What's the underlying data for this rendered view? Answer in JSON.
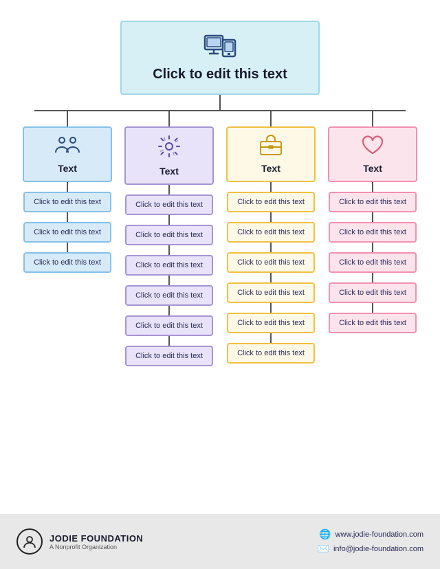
{
  "root": {
    "label": "Click to edit this text"
  },
  "branches": [
    {
      "id": "blue",
      "colorClass": "cat-blue",
      "leafClass": "leaf-blue",
      "iconType": "people",
      "label": "Text",
      "leaves": [
        "Click to edit this text",
        "Click to edit this text",
        "Click to edit this text"
      ]
    },
    {
      "id": "purple",
      "colorClass": "cat-purple",
      "leafClass": "leaf-purple",
      "iconType": "settings",
      "label": "Text",
      "leaves": [
        "Click to edit this text",
        "Click to edit this text",
        "Click to edit this text",
        "Click to edit this text",
        "Click to edit this text",
        "Click to edit this text"
      ]
    },
    {
      "id": "yellow",
      "colorClass": "cat-yellow",
      "leafClass": "leaf-yellow",
      "iconType": "briefcase",
      "label": "Text",
      "leaves": [
        "Click to edit this text",
        "Click to edit this text",
        "Click to edit this text",
        "Click to edit this text",
        "Click to edit this text",
        "Click to edit this text"
      ]
    },
    {
      "id": "pink",
      "colorClass": "cat-pink",
      "leafClass": "leaf-pink",
      "iconType": "heart",
      "label": "Text",
      "leaves": [
        "Click to edit this text",
        "Click to edit this text",
        "Click to edit this text",
        "Click to edit this text",
        "Click to edit this text"
      ]
    }
  ],
  "footer": {
    "org_name": "JODIE FOUNDATION",
    "org_sub": "A Nonprofit Organization",
    "website": "www.jodie-foundation.com",
    "email": "info@jodie-foundation.com"
  }
}
